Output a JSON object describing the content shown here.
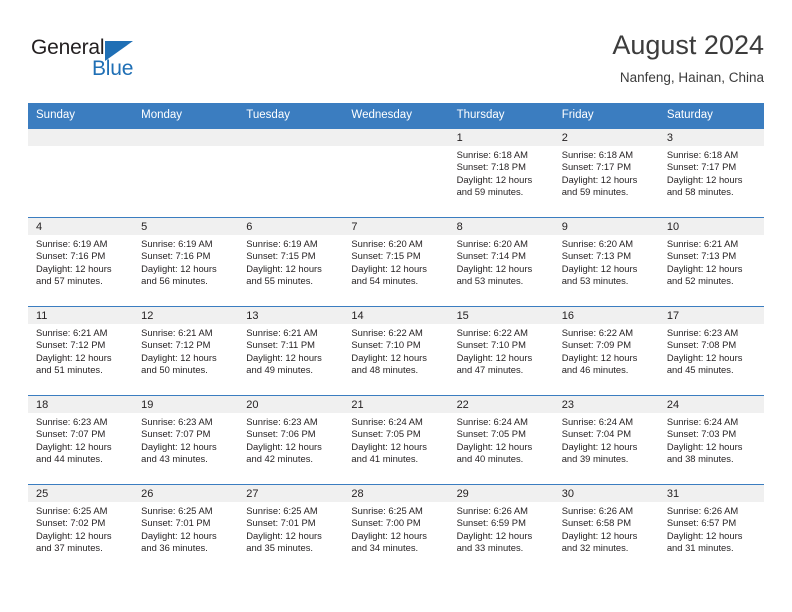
{
  "brand": {
    "name_dark": "General",
    "name_blue": "Blue",
    "accent_color": "#1f6fb5"
  },
  "header": {
    "title": "August 2024",
    "subtitle": "Nanfeng, Hainan, China"
  },
  "calendar": {
    "header_bg": "#3b7dc0",
    "weekdays": [
      "Sunday",
      "Monday",
      "Tuesday",
      "Wednesday",
      "Thursday",
      "Friday",
      "Saturday"
    ],
    "weeks": [
      [
        {
          "day": "",
          "sunrise": "",
          "sunset": "",
          "daylight_line1": "",
          "daylight_line2": ""
        },
        {
          "day": "",
          "sunrise": "",
          "sunset": "",
          "daylight_line1": "",
          "daylight_line2": ""
        },
        {
          "day": "",
          "sunrise": "",
          "sunset": "",
          "daylight_line1": "",
          "daylight_line2": ""
        },
        {
          "day": "",
          "sunrise": "",
          "sunset": "",
          "daylight_line1": "",
          "daylight_line2": ""
        },
        {
          "day": "1",
          "sunrise": "Sunrise: 6:18 AM",
          "sunset": "Sunset: 7:18 PM",
          "daylight_line1": "Daylight: 12 hours",
          "daylight_line2": "and 59 minutes."
        },
        {
          "day": "2",
          "sunrise": "Sunrise: 6:18 AM",
          "sunset": "Sunset: 7:17 PM",
          "daylight_line1": "Daylight: 12 hours",
          "daylight_line2": "and 59 minutes."
        },
        {
          "day": "3",
          "sunrise": "Sunrise: 6:18 AM",
          "sunset": "Sunset: 7:17 PM",
          "daylight_line1": "Daylight: 12 hours",
          "daylight_line2": "and 58 minutes."
        }
      ],
      [
        {
          "day": "4",
          "sunrise": "Sunrise: 6:19 AM",
          "sunset": "Sunset: 7:16 PM",
          "daylight_line1": "Daylight: 12 hours",
          "daylight_line2": "and 57 minutes."
        },
        {
          "day": "5",
          "sunrise": "Sunrise: 6:19 AM",
          "sunset": "Sunset: 7:16 PM",
          "daylight_line1": "Daylight: 12 hours",
          "daylight_line2": "and 56 minutes."
        },
        {
          "day": "6",
          "sunrise": "Sunrise: 6:19 AM",
          "sunset": "Sunset: 7:15 PM",
          "daylight_line1": "Daylight: 12 hours",
          "daylight_line2": "and 55 minutes."
        },
        {
          "day": "7",
          "sunrise": "Sunrise: 6:20 AM",
          "sunset": "Sunset: 7:15 PM",
          "daylight_line1": "Daylight: 12 hours",
          "daylight_line2": "and 54 minutes."
        },
        {
          "day": "8",
          "sunrise": "Sunrise: 6:20 AM",
          "sunset": "Sunset: 7:14 PM",
          "daylight_line1": "Daylight: 12 hours",
          "daylight_line2": "and 53 minutes."
        },
        {
          "day": "9",
          "sunrise": "Sunrise: 6:20 AM",
          "sunset": "Sunset: 7:13 PM",
          "daylight_line1": "Daylight: 12 hours",
          "daylight_line2": "and 53 minutes."
        },
        {
          "day": "10",
          "sunrise": "Sunrise: 6:21 AM",
          "sunset": "Sunset: 7:13 PM",
          "daylight_line1": "Daylight: 12 hours",
          "daylight_line2": "and 52 minutes."
        }
      ],
      [
        {
          "day": "11",
          "sunrise": "Sunrise: 6:21 AM",
          "sunset": "Sunset: 7:12 PM",
          "daylight_line1": "Daylight: 12 hours",
          "daylight_line2": "and 51 minutes."
        },
        {
          "day": "12",
          "sunrise": "Sunrise: 6:21 AM",
          "sunset": "Sunset: 7:12 PM",
          "daylight_line1": "Daylight: 12 hours",
          "daylight_line2": "and 50 minutes."
        },
        {
          "day": "13",
          "sunrise": "Sunrise: 6:21 AM",
          "sunset": "Sunset: 7:11 PM",
          "daylight_line1": "Daylight: 12 hours",
          "daylight_line2": "and 49 minutes."
        },
        {
          "day": "14",
          "sunrise": "Sunrise: 6:22 AM",
          "sunset": "Sunset: 7:10 PM",
          "daylight_line1": "Daylight: 12 hours",
          "daylight_line2": "and 48 minutes."
        },
        {
          "day": "15",
          "sunrise": "Sunrise: 6:22 AM",
          "sunset": "Sunset: 7:10 PM",
          "daylight_line1": "Daylight: 12 hours",
          "daylight_line2": "and 47 minutes."
        },
        {
          "day": "16",
          "sunrise": "Sunrise: 6:22 AM",
          "sunset": "Sunset: 7:09 PM",
          "daylight_line1": "Daylight: 12 hours",
          "daylight_line2": "and 46 minutes."
        },
        {
          "day": "17",
          "sunrise": "Sunrise: 6:23 AM",
          "sunset": "Sunset: 7:08 PM",
          "daylight_line1": "Daylight: 12 hours",
          "daylight_line2": "and 45 minutes."
        }
      ],
      [
        {
          "day": "18",
          "sunrise": "Sunrise: 6:23 AM",
          "sunset": "Sunset: 7:07 PM",
          "daylight_line1": "Daylight: 12 hours",
          "daylight_line2": "and 44 minutes."
        },
        {
          "day": "19",
          "sunrise": "Sunrise: 6:23 AM",
          "sunset": "Sunset: 7:07 PM",
          "daylight_line1": "Daylight: 12 hours",
          "daylight_line2": "and 43 minutes."
        },
        {
          "day": "20",
          "sunrise": "Sunrise: 6:23 AM",
          "sunset": "Sunset: 7:06 PM",
          "daylight_line1": "Daylight: 12 hours",
          "daylight_line2": "and 42 minutes."
        },
        {
          "day": "21",
          "sunrise": "Sunrise: 6:24 AM",
          "sunset": "Sunset: 7:05 PM",
          "daylight_line1": "Daylight: 12 hours",
          "daylight_line2": "and 41 minutes."
        },
        {
          "day": "22",
          "sunrise": "Sunrise: 6:24 AM",
          "sunset": "Sunset: 7:05 PM",
          "daylight_line1": "Daylight: 12 hours",
          "daylight_line2": "and 40 minutes."
        },
        {
          "day": "23",
          "sunrise": "Sunrise: 6:24 AM",
          "sunset": "Sunset: 7:04 PM",
          "daylight_line1": "Daylight: 12 hours",
          "daylight_line2": "and 39 minutes."
        },
        {
          "day": "24",
          "sunrise": "Sunrise: 6:24 AM",
          "sunset": "Sunset: 7:03 PM",
          "daylight_line1": "Daylight: 12 hours",
          "daylight_line2": "and 38 minutes."
        }
      ],
      [
        {
          "day": "25",
          "sunrise": "Sunrise: 6:25 AM",
          "sunset": "Sunset: 7:02 PM",
          "daylight_line1": "Daylight: 12 hours",
          "daylight_line2": "and 37 minutes."
        },
        {
          "day": "26",
          "sunrise": "Sunrise: 6:25 AM",
          "sunset": "Sunset: 7:01 PM",
          "daylight_line1": "Daylight: 12 hours",
          "daylight_line2": "and 36 minutes."
        },
        {
          "day": "27",
          "sunrise": "Sunrise: 6:25 AM",
          "sunset": "Sunset: 7:01 PM",
          "daylight_line1": "Daylight: 12 hours",
          "daylight_line2": "and 35 minutes."
        },
        {
          "day": "28",
          "sunrise": "Sunrise: 6:25 AM",
          "sunset": "Sunset: 7:00 PM",
          "daylight_line1": "Daylight: 12 hours",
          "daylight_line2": "and 34 minutes."
        },
        {
          "day": "29",
          "sunrise": "Sunrise: 6:26 AM",
          "sunset": "Sunset: 6:59 PM",
          "daylight_line1": "Daylight: 12 hours",
          "daylight_line2": "and 33 minutes."
        },
        {
          "day": "30",
          "sunrise": "Sunrise: 6:26 AM",
          "sunset": "Sunset: 6:58 PM",
          "daylight_line1": "Daylight: 12 hours",
          "daylight_line2": "and 32 minutes."
        },
        {
          "day": "31",
          "sunrise": "Sunrise: 6:26 AM",
          "sunset": "Sunset: 6:57 PM",
          "daylight_line1": "Daylight: 12 hours",
          "daylight_line2": "and 31 minutes."
        }
      ]
    ]
  }
}
